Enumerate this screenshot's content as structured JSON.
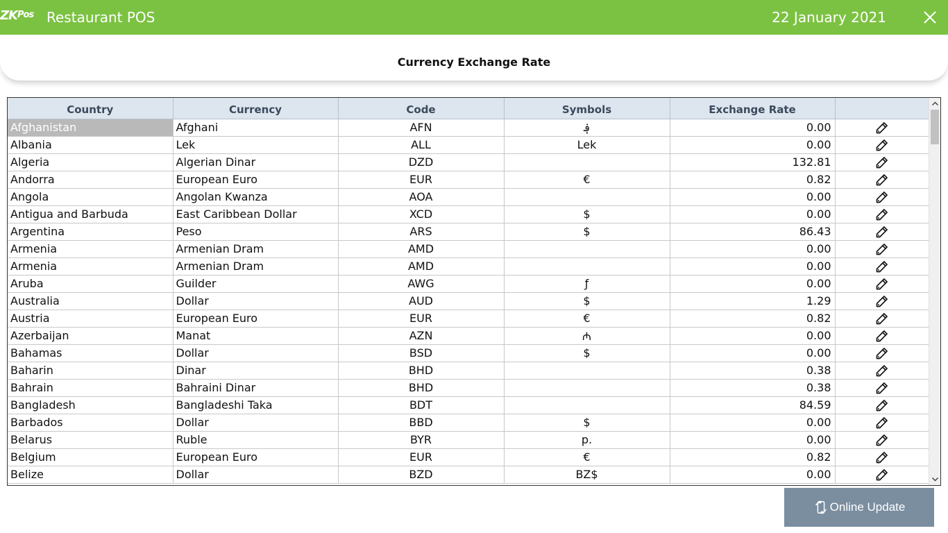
{
  "app": {
    "logo_text": "ZK",
    "logo_sub": "Pos",
    "title": "Restaurant POS",
    "date": "22 January 2021"
  },
  "page": {
    "title": "Currency Exchange Rate"
  },
  "table": {
    "columns": [
      "Country",
      "Currency",
      "Code",
      "Symbols",
      "Exchange Rate",
      ""
    ],
    "rows": [
      {
        "country": "Afghanistan",
        "currency": "Afghani",
        "code": "AFN",
        "symbol": "؋",
        "rate": "0.00"
      },
      {
        "country": "Albania",
        "currency": "Lek",
        "code": "ALL",
        "symbol": "Lek",
        "rate": "0.00"
      },
      {
        "country": "Algeria",
        "currency": "Algerian Dinar",
        "code": "DZD",
        "symbol": "",
        "rate": "132.81"
      },
      {
        "country": "Andorra",
        "currency": "European Euro",
        "code": "EUR",
        "symbol": "€",
        "rate": "0.82"
      },
      {
        "country": "Angola",
        "currency": "Angolan Kwanza",
        "code": "AOA",
        "symbol": "",
        "rate": "0.00"
      },
      {
        "country": "Antigua and Barbuda",
        "currency": "East Caribbean Dollar",
        "code": "XCD",
        "symbol": "$",
        "rate": "0.00"
      },
      {
        "country": "Argentina",
        "currency": "Peso",
        "code": "ARS",
        "symbol": "$",
        "rate": "86.43"
      },
      {
        "country": "Armenia",
        "currency": "Armenian Dram",
        "code": "AMD",
        "symbol": "",
        "rate": "0.00"
      },
      {
        "country": "Armenia",
        "currency": "Armenian Dram",
        "code": "AMD",
        "symbol": "",
        "rate": "0.00"
      },
      {
        "country": "Aruba",
        "currency": "Guilder",
        "code": "AWG",
        "symbol": "ƒ",
        "rate": "0.00"
      },
      {
        "country": "Australia",
        "currency": "Dollar",
        "code": "AUD",
        "symbol": "$",
        "rate": "1.29"
      },
      {
        "country": "Austria",
        "currency": "European Euro",
        "code": "EUR",
        "symbol": "€",
        "rate": "0.82"
      },
      {
        "country": "Azerbaijan",
        "currency": "Manat",
        "code": "AZN",
        "symbol": "₼",
        "rate": "0.00"
      },
      {
        "country": "Bahamas",
        "currency": "Dollar",
        "code": "BSD",
        "symbol": "$",
        "rate": "0.00"
      },
      {
        "country": "Baharin",
        "currency": "Dinar",
        "code": "BHD",
        "symbol": "",
        "rate": "0.38"
      },
      {
        "country": "Bahrain",
        "currency": "Bahraini Dinar",
        "code": "BHD",
        "symbol": "",
        "rate": "0.38"
      },
      {
        "country": "Bangladesh",
        "currency": "Bangladeshi Taka",
        "code": "BDT",
        "symbol": "",
        "rate": "84.59"
      },
      {
        "country": "Barbados",
        "currency": "Dollar",
        "code": "BBD",
        "symbol": "$",
        "rate": "0.00"
      },
      {
        "country": "Belarus",
        "currency": "Ruble",
        "code": "BYR",
        "symbol": "p.",
        "rate": "0.00"
      },
      {
        "country": "Belgium",
        "currency": "European Euro",
        "code": "EUR",
        "symbol": "€",
        "rate": "0.82"
      },
      {
        "country": "Belize",
        "currency": "Dollar",
        "code": "BZD",
        "symbol": "BZ$",
        "rate": "0.00"
      }
    ],
    "selected_row": 0
  },
  "actions": {
    "online_update_label": "Online Update"
  },
  "colors": {
    "header_green": "#7cc242",
    "grid_header": "#dde5ef",
    "button_gray": "#7b8ea0",
    "selected_cell": "#b9b9b9"
  },
  "icons": {
    "close": "close-icon",
    "edit": "pencil-icon",
    "refresh": "refresh-icon"
  }
}
